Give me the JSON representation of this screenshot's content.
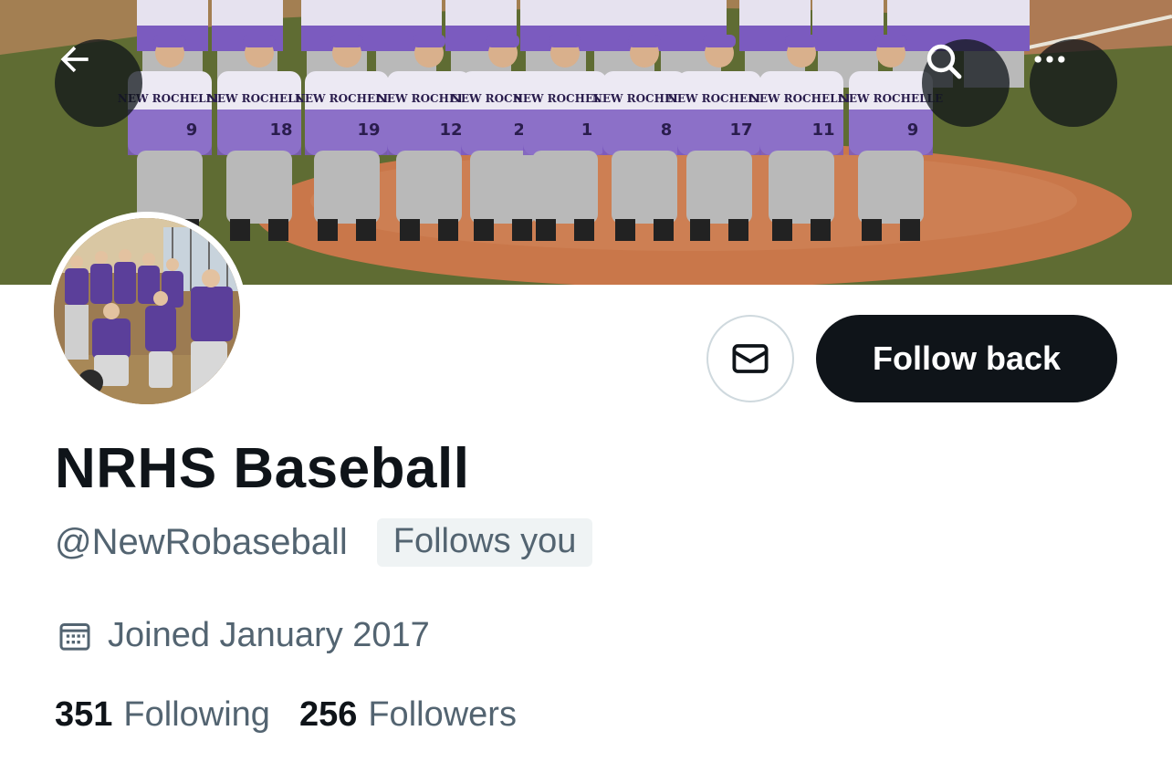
{
  "banner": {
    "jersey_text": "NEW ROCHELLE",
    "jersey_numbers": [
      "9",
      "18",
      "19",
      "12",
      "22",
      "1",
      "8",
      "17",
      "11"
    ],
    "colors": {
      "purple": "#7b5bbf",
      "grass": "#5d6a33",
      "dirt": "#c9774a",
      "pants": "#b9b9b9"
    }
  },
  "nav": {
    "back_icon": "arrow-left-icon",
    "search_icon": "search-icon",
    "more_icon": "more-horizontal-icon"
  },
  "actions": {
    "message_icon": "envelope-icon",
    "follow_label": "Follow back"
  },
  "profile": {
    "display_name": "NRHS Baseball",
    "handle": "@NewRobaseball",
    "follows_you": "Follows you",
    "joined_icon": "calendar-icon",
    "joined": "Joined January 2017",
    "following_count": "351",
    "following_label": "Following",
    "followers_count": "256",
    "followers_label": "Followers"
  },
  "colors": {
    "text_primary": "#0f1419",
    "text_secondary": "#536471",
    "button_dark": "#0f1419",
    "badge_bg": "#eff3f4",
    "border": "#cfd9de"
  }
}
